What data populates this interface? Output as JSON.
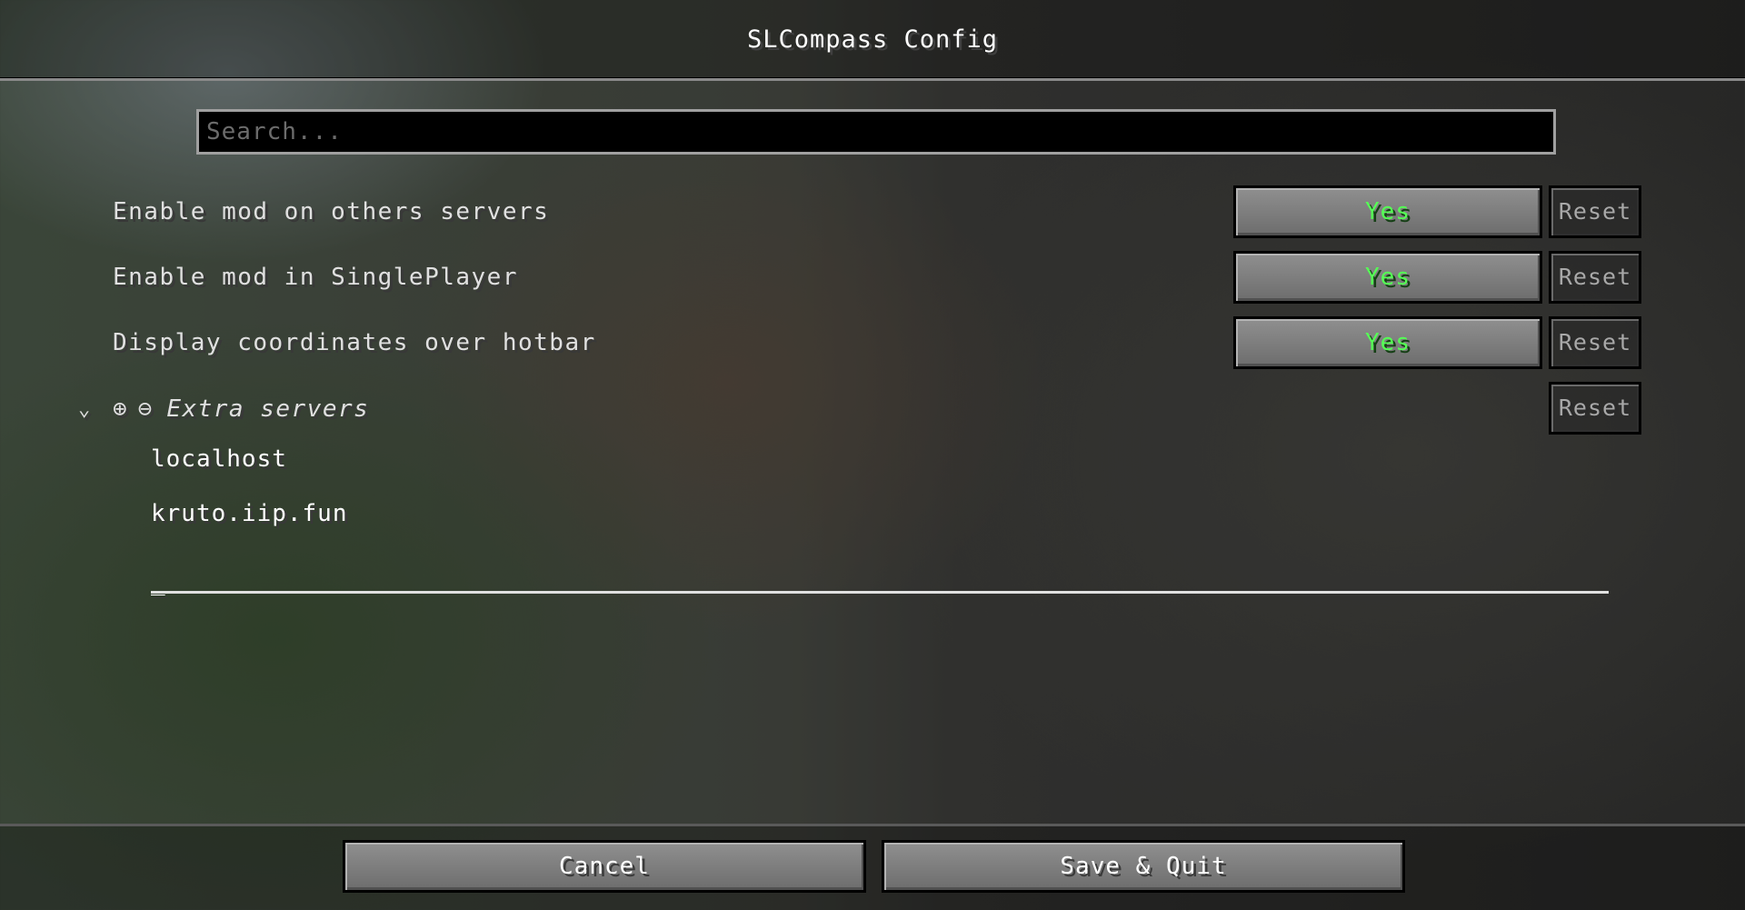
{
  "window": {
    "title": "SLCompass Config"
  },
  "search": {
    "placeholder": "Search..."
  },
  "options": [
    {
      "label": "Enable mod on others servers",
      "value": "Yes",
      "reset": "Reset"
    },
    {
      "label": "Enable mod in SinglePlayer",
      "value": "Yes",
      "reset": "Reset"
    },
    {
      "label": "Display coordinates over hotbar",
      "value": "Yes",
      "reset": "Reset"
    }
  ],
  "extra_servers": {
    "title": "Extra servers",
    "reset": "Reset",
    "expand_icon": "chevron-down-icon",
    "add_icon": "plus-circle-icon",
    "remove_icon": "minus-circle-icon",
    "add_glyph": "⊕",
    "remove_glyph": "⊖",
    "chevron_glyph": "⌄",
    "items": [
      "localhost",
      "kruto.iip.fun"
    ],
    "new_entry_cursor": "_"
  },
  "footer": {
    "cancel": "Cancel",
    "save": "Save & Quit"
  },
  "colors": {
    "value_on": "#55ff55",
    "text": "#e0e0e0",
    "reset_disabled": "#a8a8a8"
  }
}
